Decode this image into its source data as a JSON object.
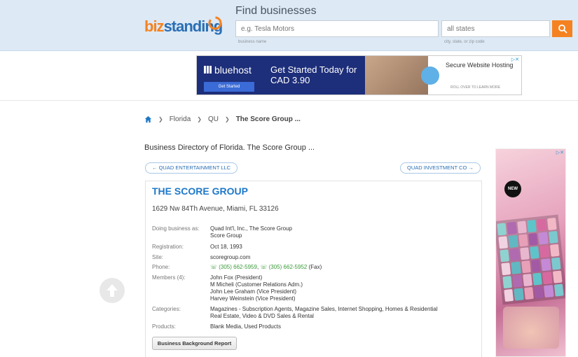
{
  "header": {
    "logo_biz": "biz",
    "logo_standing": "standing",
    "find_title": "Find businesses",
    "search_placeholder": "e.g. Tesla Motors",
    "search_hint": "business name",
    "location_placeholder": "all states",
    "location_hint": "city, state, or zip code",
    "search_button_icon": "search-icon"
  },
  "ad_banner": {
    "brand": "bluehost",
    "cta": "Get Started",
    "headline": "Get Started Today for CAD 3.90",
    "secure": "Secure Website Hosting",
    "rollover": "ROLL OVER TO LEARN MORE",
    "close": "▷✕"
  },
  "breadcrumb": {
    "items": [
      "Florida",
      "QU",
      "The Score Group ..."
    ]
  },
  "page": {
    "heading": "Business Directory of Florida. The Score Group ...",
    "prev_link": "← QUAD ENTERTAINMENT LLC",
    "next_link": "QUAD INVESTMENT CO →"
  },
  "company": {
    "name": "THE SCORE GROUP",
    "address": "1629 Nw 84Th Avenue, Miami, FL 33126",
    "dba_label": "Doing business as:",
    "dba": [
      "Quad Int'l, Inc., The Score Group",
      "Score Group"
    ],
    "registration_label": "Registration:",
    "registration": "Oct 18, 1993",
    "site_label": "Site:",
    "site": "scoregroup.com",
    "phone_label": "Phone:",
    "phone_1": "(305) 662-5959",
    "phone_2": "(305) 662-5952",
    "fax_suffix": "(Fax)",
    "members_label": "Members (4):",
    "members": [
      "John Fox (President)",
      "M Micheli (Customer Relations Adm.)",
      "John Lee Graham (Vice President)",
      "Harvey Weinstein (Vice President)"
    ],
    "categories_label": "Categories:",
    "categories": [
      "Magazines - Subscription Agents, Magazine Sales, Internet Shopping, Homes & Residential",
      "Real Estate, Video & DVD Sales & Rental"
    ],
    "products_label": "Products:",
    "products": "Blank Media, Used Products",
    "report_button": "Business Background Report"
  },
  "side_ad": {
    "badge": "NEW",
    "close": "▷✕"
  },
  "colors": {
    "accent": "#1e78c8",
    "brand_orange": "#f58220",
    "phone_green": "#3b9b3b"
  }
}
